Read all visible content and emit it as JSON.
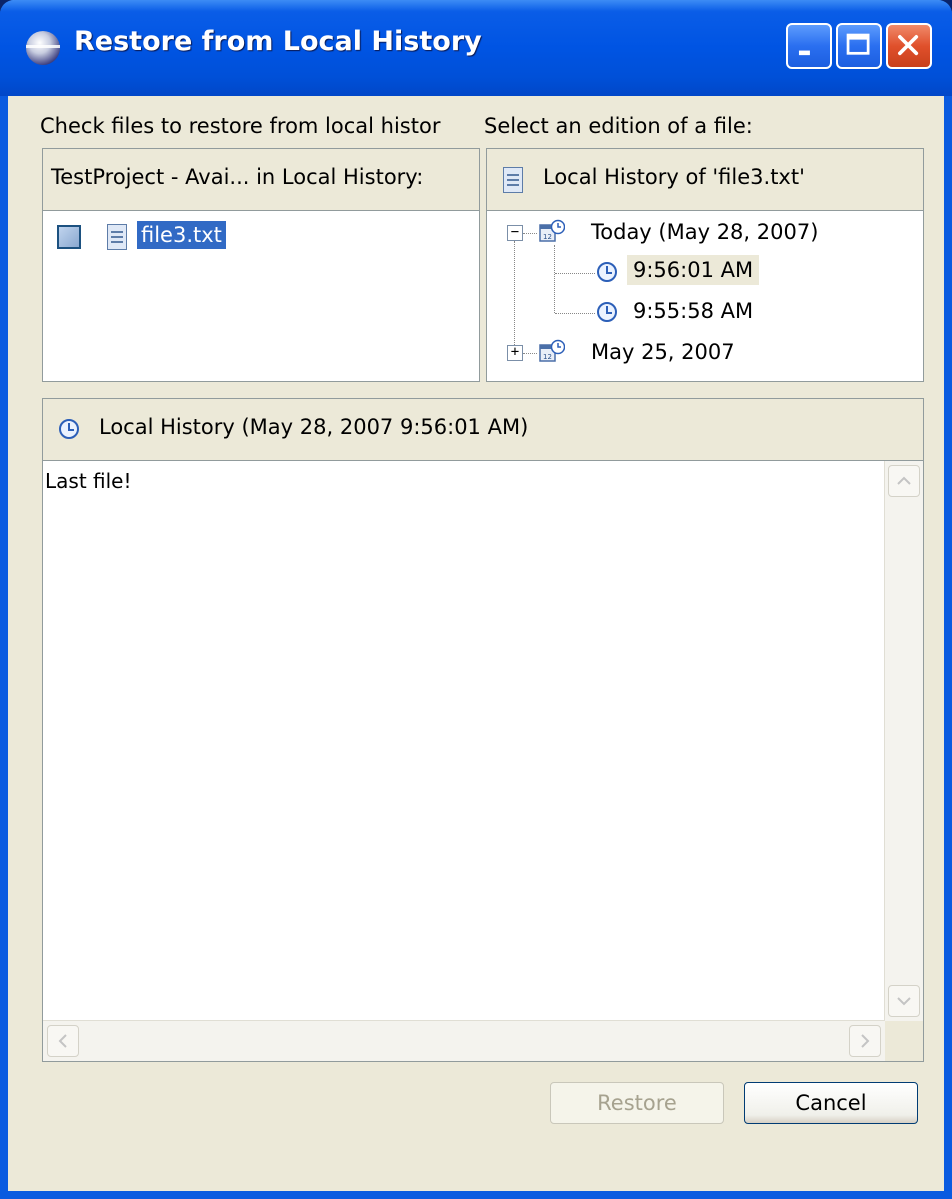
{
  "window": {
    "title": "Restore from Local History"
  },
  "left": {
    "instruction": "Check files to restore from local histor",
    "header": "TestProject - Avai... in Local History:",
    "files": [
      {
        "name": "file3.txt",
        "checked": false,
        "selected": true
      }
    ]
  },
  "right": {
    "instruction": "Select an edition of a file:",
    "header": "Local History of 'file3.txt'",
    "tree": {
      "today_label": "Today (May 28, 2007)",
      "today_entries": [
        "9:56:01 AM",
        "9:55:58 AM"
      ],
      "older_label": "May 25, 2007"
    }
  },
  "preview": {
    "header": "Local History (May 28, 2007 9:56:01 AM)",
    "content": "Last file!"
  },
  "buttons": {
    "restore": "Restore",
    "cancel": "Cancel"
  },
  "icons": {
    "window": "eclipse-icon",
    "minimize": "minimize-icon",
    "maximize": "maximize-icon",
    "close": "close-icon"
  },
  "colors": {
    "selection": "#316ac5",
    "titlebar": "#0054e3",
    "dialog_bg": "#ece9d8"
  }
}
